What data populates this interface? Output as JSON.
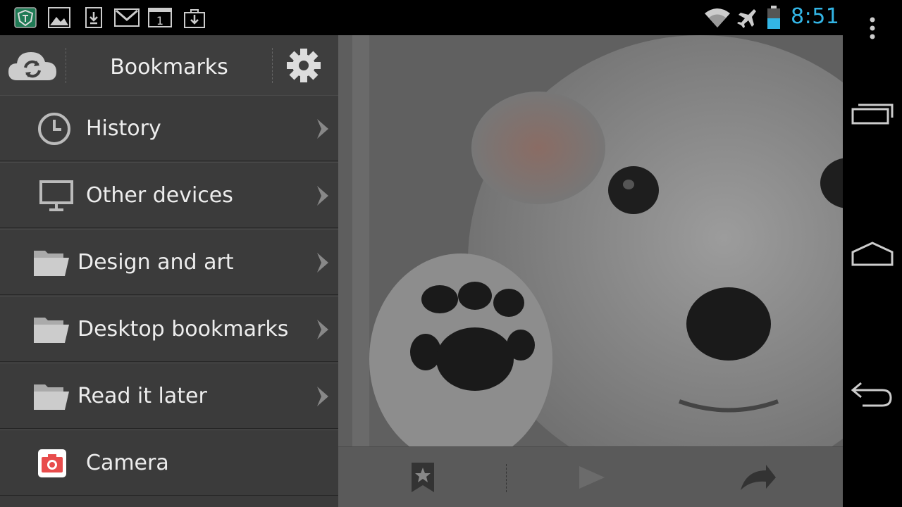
{
  "status_bar": {
    "time": "8:51",
    "notification_icons": [
      "shield-app-icon",
      "image-icon",
      "download-icon",
      "gmail-icon",
      "calendar-icon",
      "download-bag-icon"
    ],
    "calendar_day": "1",
    "status_icons": [
      "wifi-icon",
      "airplane-mode-icon",
      "battery-icon"
    ],
    "accent_color": "#33b5e5"
  },
  "drawer": {
    "title": "Bookmarks",
    "items": [
      {
        "label": "History",
        "icon": "clock-icon"
      },
      {
        "label": "Other devices",
        "icon": "monitor-icon"
      },
      {
        "label": "Design and art",
        "icon": "folder-icon"
      },
      {
        "label": "Desktop bookmarks",
        "icon": "folder-icon"
      },
      {
        "label": "Read it later",
        "icon": "folder-icon"
      },
      {
        "label": "Camera",
        "icon": "camera-app-icon"
      }
    ]
  },
  "toolbar": {
    "buttons": [
      "bookmark-star-icon",
      "forward-play-icon",
      "share-curved-arrow-icon"
    ]
  },
  "nav_bar": {
    "buttons": [
      "overflow-menu-icon",
      "recent-apps-icon",
      "home-icon",
      "back-icon"
    ]
  }
}
